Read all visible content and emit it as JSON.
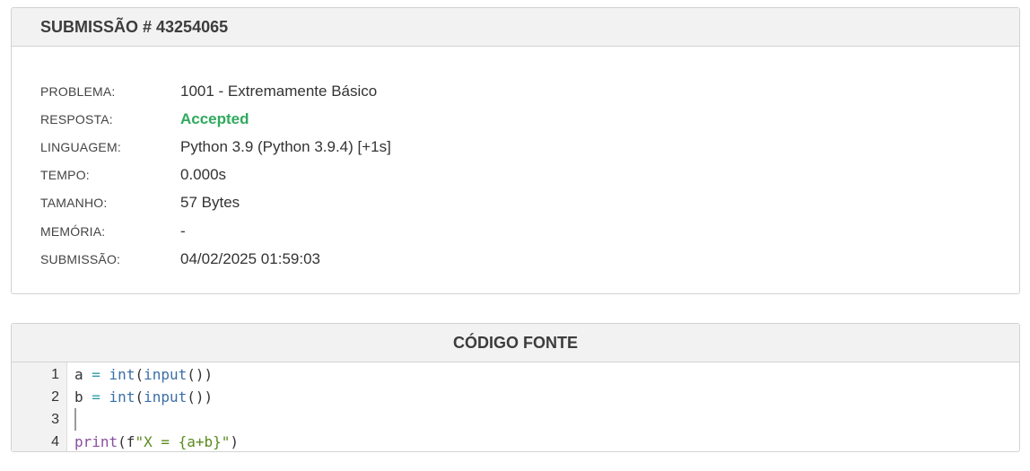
{
  "submission": {
    "title": "SUBMISSÃO # 43254065",
    "rows": [
      {
        "label": "PROBLEMA:",
        "value": "1001 - Extremamente Básico"
      },
      {
        "label": "RESPOSTA:",
        "value": "Accepted"
      },
      {
        "label": "LINGUAGEM:",
        "value": "Python 3.9 (Python 3.9.4) [+1s]"
      },
      {
        "label": "TEMPO:",
        "value": "0.000s"
      },
      {
        "label": "TAMANHO:",
        "value": "57 Bytes"
      },
      {
        "label": "MEMÓRIA:",
        "value": "-"
      },
      {
        "label": "SUBMISSÃO:",
        "value": "04/02/2025 01:59:03"
      }
    ],
    "accepted_color": "#2eaa5c"
  },
  "code": {
    "title": "CÓDIGO FONTE",
    "line_numbers": [
      "1",
      "2",
      "3",
      "4"
    ],
    "lines": [
      [
        {
          "t": "a ",
          "c": "plain"
        },
        {
          "t": "=",
          "c": "op"
        },
        {
          "t": " ",
          "c": "plain"
        },
        {
          "t": "int",
          "c": "builtin"
        },
        {
          "t": "(",
          "c": "punct"
        },
        {
          "t": "input",
          "c": "builtin"
        },
        {
          "t": "())",
          "c": "punct"
        }
      ],
      [
        {
          "t": "b ",
          "c": "plain"
        },
        {
          "t": "=",
          "c": "op"
        },
        {
          "t": " ",
          "c": "plain"
        },
        {
          "t": "int",
          "c": "builtin"
        },
        {
          "t": "(",
          "c": "punct"
        },
        {
          "t": "input",
          "c": "builtin"
        },
        {
          "t": "())",
          "c": "punct"
        }
      ],
      [],
      [
        {
          "t": "print",
          "c": "print"
        },
        {
          "t": "(f",
          "c": "punct"
        },
        {
          "t": "\"X = {a+b}\"",
          "c": "str"
        },
        {
          "t": ")",
          "c": "punct"
        }
      ]
    ],
    "cursor_line": 3,
    "colors": {
      "operator": "#2e9aa6",
      "builtin": "#3b6fa8",
      "print": "#8a4fa0",
      "string": "#5a8a1e"
    }
  }
}
